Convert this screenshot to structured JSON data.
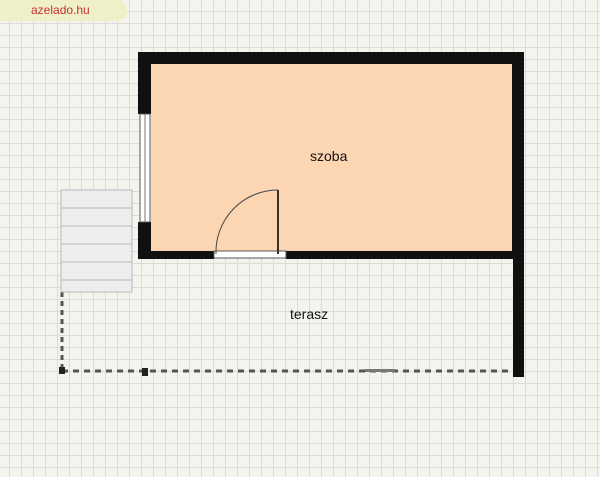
{
  "site": {
    "watermark": "azelado.hu"
  },
  "floorplan": {
    "rooms": [
      {
        "id": "szoba",
        "label": "szoba",
        "fill": "#fcd6b3"
      },
      {
        "id": "terasz",
        "label": "terasz",
        "fill": "none"
      }
    ]
  },
  "colors": {
    "wall": "#101010",
    "grid": "#dcdcd4",
    "background": "#f4f4ef"
  }
}
